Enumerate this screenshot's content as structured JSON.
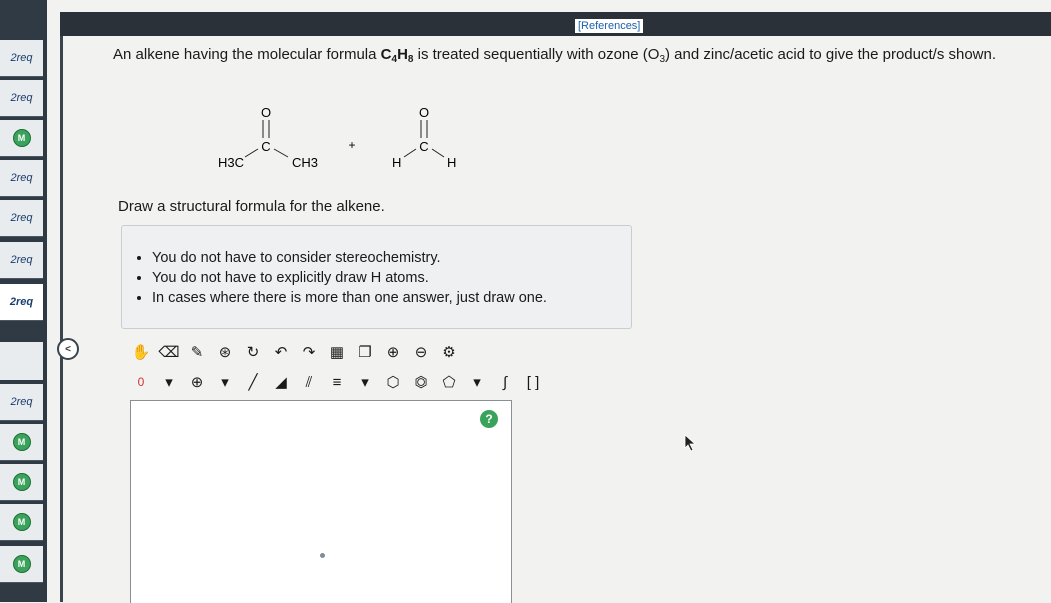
{
  "header": {
    "references_label": "[References]"
  },
  "sidebar": {
    "items": [
      {
        "label": "2req",
        "type": "req"
      },
      {
        "label": "2req",
        "type": "req"
      },
      {
        "label": "M",
        "type": "badge"
      },
      {
        "label": "2req",
        "type": "req"
      },
      {
        "label": "2req",
        "type": "req"
      },
      {
        "label": "2req",
        "type": "req"
      },
      {
        "label": "2req",
        "type": "req",
        "active": true
      },
      {
        "label": "2req",
        "type": "req"
      },
      {
        "label": "M",
        "type": "badge"
      },
      {
        "label": "M",
        "type": "badge"
      },
      {
        "label": "M",
        "type": "badge"
      },
      {
        "label": "M",
        "type": "badge"
      }
    ],
    "collapse_label": "<"
  },
  "question": {
    "text_before": "An alkene having the molecular formula ",
    "formula_c": "C",
    "formula_c_sub": "4",
    "formula_h": "H",
    "formula_h_sub": "8",
    "text_mid": " is treated sequentially with ozone (O",
    "ozone_sub": "3",
    "text_after": ") and zinc/acetic acid to give the product/s shown."
  },
  "molecule": {
    "left": {
      "o": "O",
      "c": "C",
      "left_group": "H3C",
      "right_group": "CH3"
    },
    "plus": "+",
    "right": {
      "o": "O",
      "c": "C",
      "left_group": "H",
      "right_group": "H"
    }
  },
  "prompt": "Draw a structural formula for the alkene.",
  "hints": [
    "You do not have to consider stereochemistry.",
    "You do not have to explicitly draw H atoms.",
    "In cases where there is more than one answer, just draw one."
  ],
  "toolbar2": {
    "charge_label": "0",
    "plus_label": "⊕"
  },
  "help_label": "?",
  "colors": {
    "accent_green": "#3aa35b",
    "link_blue": "#1c5fae",
    "dark_bar": "#2b3138"
  }
}
